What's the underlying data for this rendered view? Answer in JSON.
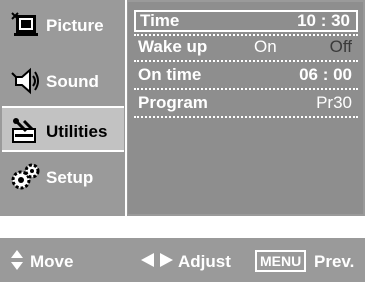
{
  "sidebar": {
    "items": [
      {
        "label": "Picture",
        "icon": "picture-icon",
        "active": false
      },
      {
        "label": "Sound",
        "icon": "speaker-icon",
        "active": false
      },
      {
        "label": "Utilities",
        "icon": "tools-icon",
        "active": true
      },
      {
        "label": "Setup",
        "icon": "gears-icon",
        "active": false
      }
    ]
  },
  "panel": {
    "rows": [
      {
        "name": "Time",
        "value": "10 : 30"
      },
      {
        "name": "Wake up",
        "value_left": "On",
        "value": "Off"
      },
      {
        "name": "On time",
        "value": "06 : 00"
      },
      {
        "name": "Program",
        "value": "Pr30"
      }
    ]
  },
  "hints": {
    "move": "Move",
    "adjust": "Adjust",
    "menu_key": "MENU",
    "prev": "Prev."
  },
  "colors": {
    "osd_bg": "#9a9a9a",
    "panel_bg": "#8e8e8e",
    "active_item_bg": "#c2c2c2",
    "text": "#ffffff"
  }
}
